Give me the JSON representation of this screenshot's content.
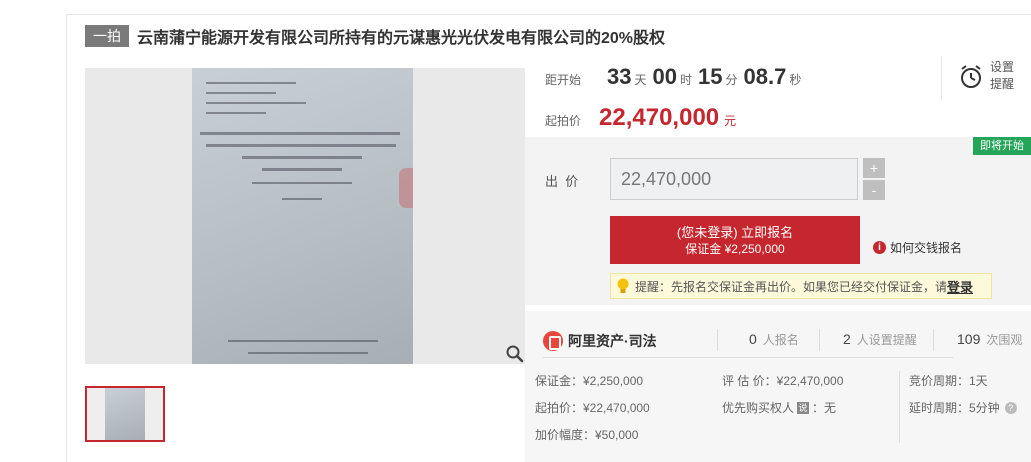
{
  "header": {
    "badge": "一拍",
    "title": "云南蒲宁能源开发有限公司所持有的元谋惠光光伏发电有限公司的20%股权"
  },
  "countdown": {
    "label": "距开始",
    "days": "33",
    "days_unit": "天",
    "hours": "00",
    "hours_unit": "时",
    "minutes": "15",
    "minutes_unit": "分",
    "seconds": "08.7",
    "seconds_unit": "秒"
  },
  "remind": {
    "line1": "设置",
    "line2": "提醒",
    "icon": "alarm-clock-icon"
  },
  "start_price": {
    "label": "起拍价",
    "value": "22,470,000",
    "unit": "元"
  },
  "bid": {
    "status_tag": "即将开始",
    "label": "出  价",
    "input_value": "22,470,000",
    "plus": "+",
    "minus": "-",
    "register_line1": "(您未登录) 立即报名",
    "register_line2": "保证金 ¥2,250,000",
    "howto": "如何交钱报名",
    "tip_text": "提醒：先报名交保证金再出价。如果您已经交付保证金，请",
    "tip_login": "登录"
  },
  "platform": {
    "brand": "阿里资产·司法",
    "stats": [
      {
        "num": "0",
        "label": "人报名"
      },
      {
        "num": "2",
        "label": "人设置提醒"
      },
      {
        "num": "109",
        "label": "次围观"
      }
    ]
  },
  "details": {
    "deposit": "保证金：¥2,250,000",
    "start_price": "起拍价：¥22,470,000",
    "increment": "加价幅度：¥50,000",
    "appraisal": "评 估 价：¥22,470,000",
    "priority_label": "优先购买权人",
    "priority_badge": "说",
    "priority_value": "：无",
    "cycle": "竞价周期：1天",
    "delay": "延时周期：5分钟"
  },
  "colors": {
    "accent": "#c6262e",
    "status_green": "#25a55a",
    "tip_bg": "#fff9db"
  }
}
